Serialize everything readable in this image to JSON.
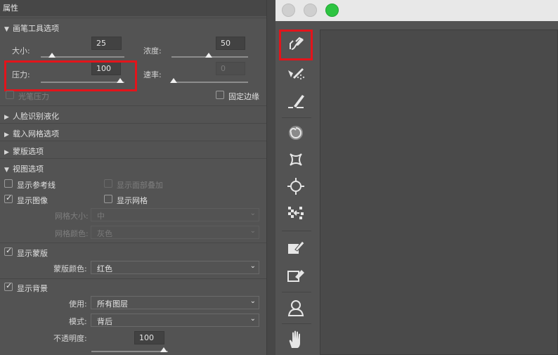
{
  "panel": {
    "title": "属性"
  },
  "brush": {
    "header": "画笔工具选项",
    "size_label": "大小:",
    "size_value": "25",
    "density_label": "浓度:",
    "density_value": "50",
    "pressure_label": "压力:",
    "pressure_value": "100",
    "rate_label": "速率:",
    "rate_value": "0",
    "stylus_label": "光笔压力",
    "pin_edges_label": "固定边缘"
  },
  "sections": {
    "face": "人脸识别液化",
    "mesh": "载入网格选项",
    "mask": "蒙版选项",
    "view": "视图选项"
  },
  "view": {
    "guides": "显示参考线",
    "face_overlay": "显示面部叠加",
    "image": "显示图像",
    "mesh": "显示网格",
    "mesh_size_label": "网格大小:",
    "mesh_size_value": "中",
    "mesh_color_label": "网格颜色:",
    "mesh_color_value": "灰色",
    "show_mask": "显示蒙版",
    "mask_color_label": "蒙版颜色:",
    "mask_color_value": "红色",
    "show_backdrop": "显示背景",
    "use_label": "使用:",
    "use_value": "所有图层",
    "mode_label": "模式:",
    "mode_value": "背后",
    "opacity_label": "不透明度:",
    "opacity_value": "100"
  },
  "tools": [
    "forward-warp-icon",
    "reconstruct-icon",
    "smooth-icon",
    "twirl-clockwise-icon",
    "pucker-icon",
    "bloat-icon",
    "push-left-icon",
    "freeze-mask-icon",
    "thaw-mask-icon",
    "face-tool-icon",
    "hand-icon"
  ],
  "colors": {
    "highlight": "#e3141b",
    "window_green": "#2dc441"
  }
}
